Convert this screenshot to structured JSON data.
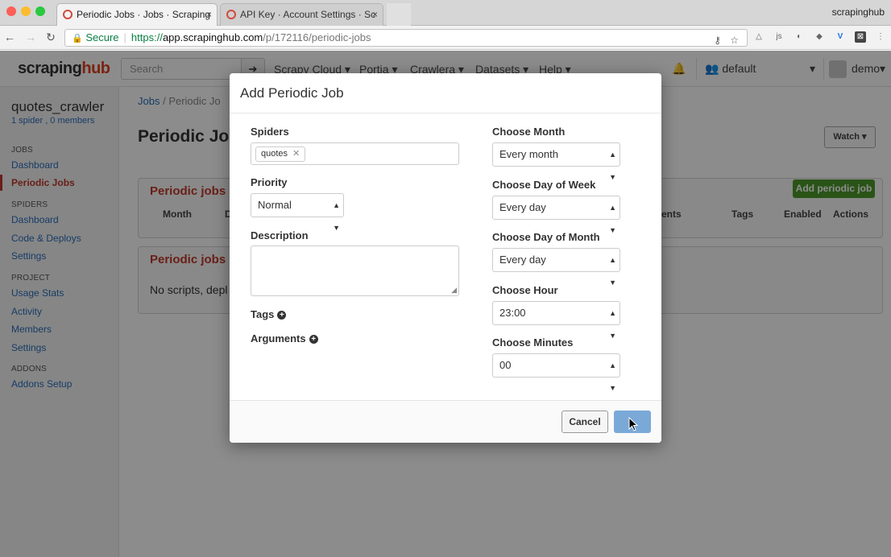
{
  "browser": {
    "tabs": [
      {
        "title": "Periodic Jobs · Jobs · Scraping",
        "close": "×"
      },
      {
        "title": "API Key · Account Settings · Sc",
        "close": "×"
      }
    ],
    "profile": "scrapinghub",
    "url": {
      "secure_label": "Secure",
      "scheme": "https://",
      "host": "app.scrapinghub.com",
      "path": "/p/172116/periodic-jobs"
    }
  },
  "app": {
    "logo_a": "scraping",
    "logo_b": "hub",
    "search_placeholder": "Search",
    "nav": [
      "Scrapy Cloud ▾",
      "Portia ▾",
      "Crawlera ▾",
      "Datasets ▾",
      "Help ▾"
    ],
    "org": "default",
    "user": "demo"
  },
  "sidebar": {
    "project": "quotes_crawler",
    "summary": "1 spider , 0 members",
    "sections": [
      {
        "head": "JOBS",
        "items": [
          "Dashboard",
          "Periodic Jobs"
        ]
      },
      {
        "head": "SPIDERS",
        "items": [
          "Dashboard",
          "Code & Deploys",
          "Settings"
        ]
      },
      {
        "head": "PROJECT",
        "items": [
          "Usage Stats",
          "Activity",
          "Members",
          "Settings"
        ]
      },
      {
        "head": "ADDONS",
        "items": [
          "Addons Setup"
        ]
      }
    ]
  },
  "main": {
    "breadcrumb": [
      "Jobs",
      "Periodic Jo"
    ],
    "page_title": "Periodic Jol",
    "watch": "Watch ▾",
    "panel1_title": "Periodic jobs (",
    "add_button": "Add periodic job",
    "columns": [
      "Month",
      "D",
      "ents",
      "Tags",
      "Enabled",
      "Actions"
    ],
    "panel2_title": "Periodic jobs (",
    "empty_text": "No scripts, depl"
  },
  "modal": {
    "title": "Add Periodic Job",
    "spiders_label": "Spiders",
    "spider_chip": "quotes",
    "priority_label": "Priority",
    "priority_value": "Normal",
    "description_label": "Description",
    "tags_label": "Tags",
    "arguments_label": "Arguments",
    "month_label": "Choose Month",
    "month_value": "Every month",
    "dow_label": "Choose Day of Week",
    "dow_value": "Every day",
    "dom_label": "Choose Day of Month",
    "dom_value": "Every day",
    "hour_label": "Choose Hour",
    "hour_value": "23:00",
    "minutes_label": "Choose Minutes",
    "minutes_value": "00",
    "cancel": "Cancel"
  }
}
